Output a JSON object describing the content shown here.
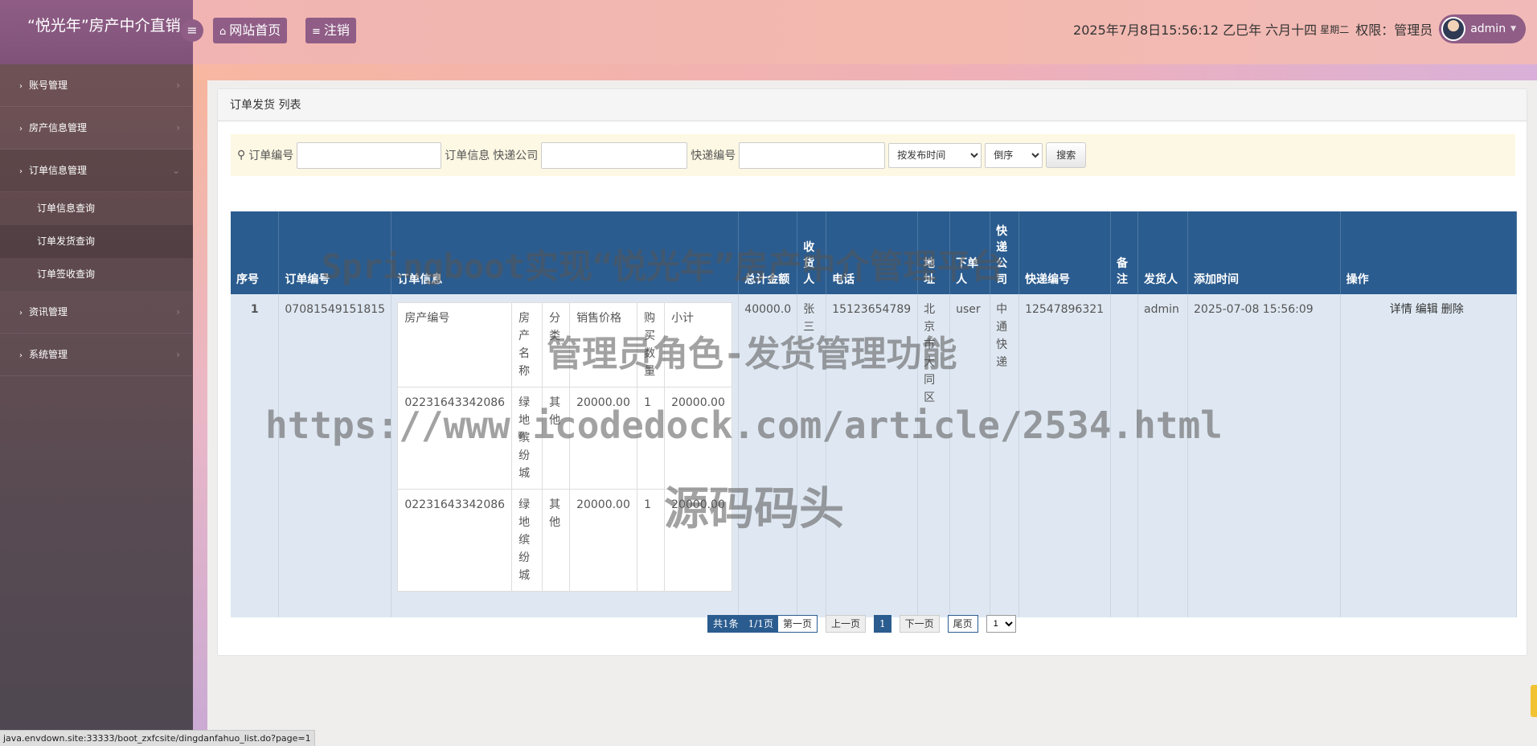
{
  "header": {
    "brand": "“悦光年”房产中介直销",
    "menu_toggle_icon": "bars-icon",
    "home_button": "网站首页",
    "logout_button": "注销",
    "datetime": "2025年7月8日15:56:12 乙巳年 六月十四",
    "weekday": "星期二",
    "permission": "权限：管理员",
    "username": "admin"
  },
  "sidebar": {
    "items": [
      {
        "label": "账号管理"
      },
      {
        "label": "房产信息管理"
      },
      {
        "label": "订单信息管理"
      },
      {
        "label": "资讯管理"
      },
      {
        "label": "系统管理"
      }
    ],
    "sub_items": [
      {
        "label": "订单信息查询"
      },
      {
        "label": "订单发货查询"
      },
      {
        "label": "订单签收查询"
      }
    ]
  },
  "panel": {
    "title": "订单发货 列表"
  },
  "search": {
    "label_order_no": "订单编号",
    "label_order_info": "订单信息",
    "label_courier": "快递公司",
    "label_tracking": "快递编号",
    "sort_field": "按发布时间",
    "sort_order": "倒序",
    "button": "搜索"
  },
  "table": {
    "headers": [
      "序号",
      "订单编号",
      "订单信息",
      "总计金额",
      "收货人",
      "电话",
      "地址",
      "下单人",
      "快递公司",
      "快递编号",
      "备注",
      "发货人",
      "添加时间",
      "操作"
    ],
    "row": {
      "index": "1",
      "order_no": "07081549151815",
      "total": "40000.0",
      "receiver": "张三",
      "phone": "15123654789",
      "address": "北京市大同区",
      "buyer": "user",
      "courier": "中通快递",
      "tracking": "12547896321",
      "remark": "",
      "shipper": "admin",
      "time": "2025-07-08 15:56:09",
      "ops": [
        "详情",
        "编辑",
        "删除"
      ]
    },
    "inner_headers": [
      "房产编号",
      "房产名称",
      "分类",
      "销售价格",
      "购买数量",
      "小计"
    ],
    "inner_rows": [
      [
        "02231643342086",
        "绿地缤纷城",
        "其他",
        "20000.00",
        "1",
        "20000.00"
      ],
      [
        "02231643342086",
        "绿地缤纷城",
        "其他",
        "20000.00",
        "1",
        "20000.00"
      ]
    ]
  },
  "pager": {
    "total": "共1条",
    "pages": "1/1页",
    "first": "第一页",
    "prev": "上一页",
    "current": "1",
    "next": "下一页",
    "last": "尾页",
    "select": "1"
  },
  "watermark": {
    "line1": "Springboot实现“悦光年”房产中介管理平台",
    "line2": "管理员角色-发货管理功能",
    "line3": "https://www.icodedock.com/article/2534.html",
    "line4": "源码码头"
  },
  "statusbar": "java.envdown.site:33333/boot_zxfcsite/dingdanfahuo_list.do?page=1"
}
